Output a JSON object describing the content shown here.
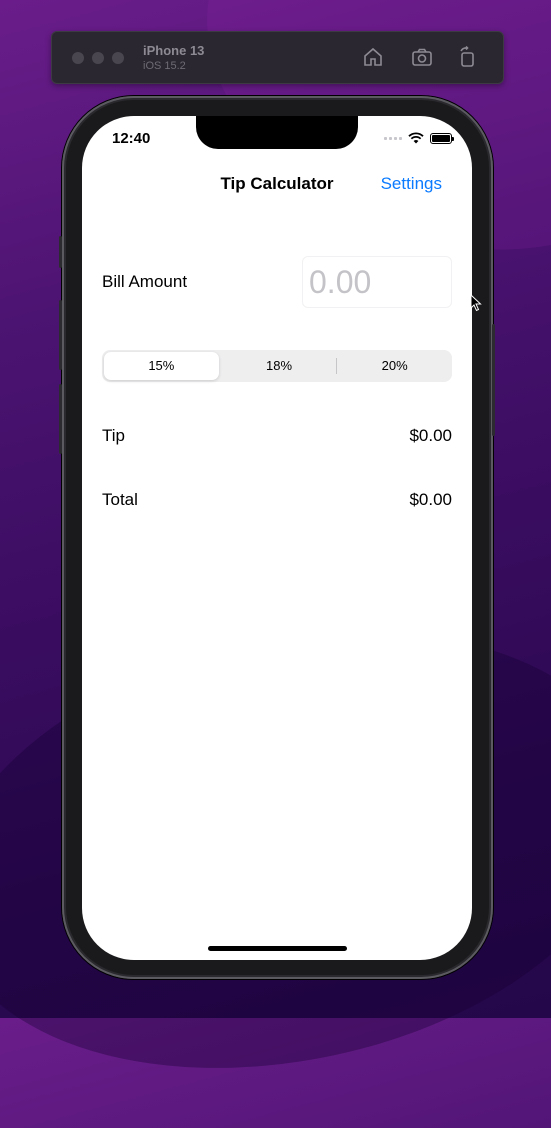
{
  "simulator": {
    "device_name": "iPhone 13",
    "os_version": "iOS 15.2",
    "icons": [
      "home-icon",
      "screenshot-icon",
      "rotate-icon"
    ]
  },
  "status_bar": {
    "time": "12:40",
    "icons": [
      "signal-icon",
      "wifi-icon",
      "battery-icon"
    ]
  },
  "nav": {
    "title": "Tip Calculator",
    "settings_label": "Settings"
  },
  "bill": {
    "label": "Bill Amount",
    "value": "",
    "placeholder": "0.00"
  },
  "tip_segments": {
    "options": [
      "15%",
      "18%",
      "20%"
    ],
    "selected": "15%"
  },
  "results": {
    "tip_label": "Tip",
    "tip_value": "$0.00",
    "total_label": "Total",
    "total_value": "$0.00"
  },
  "colors": {
    "accent": "#0a7aff",
    "background": "#ffffff",
    "desktop": "#3a0c60"
  }
}
